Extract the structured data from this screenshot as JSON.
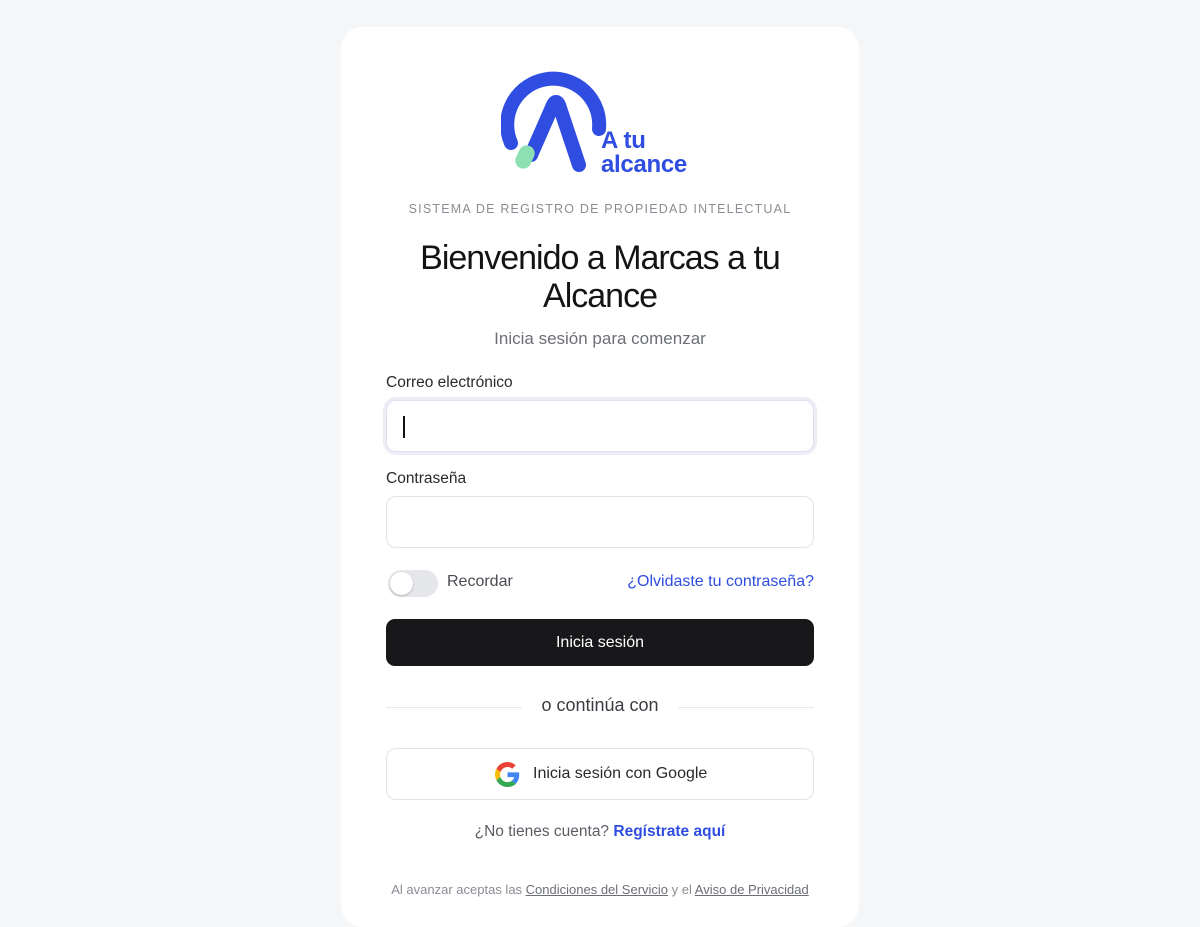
{
  "brand": {
    "logo_line1": "A tu",
    "logo_line2": "alcance",
    "primary_color": "#2f4de0",
    "accent_color": "#8ce0b3"
  },
  "header": {
    "eyebrow": "SISTEMA DE REGISTRO DE PROPIEDAD INTELECTUAL",
    "title": "Bienvenido a Marcas a tu Alcance",
    "subtitle": "Inicia sesión para comenzar"
  },
  "form": {
    "email_label": "Correo electrónico",
    "email_value": "",
    "password_label": "Contraseña",
    "password_value": "",
    "remember_label": "Recordar",
    "remember_checked": false,
    "forgot_link": "¿Olvidaste tu contraseña?",
    "submit_label": "Inicia sesión"
  },
  "alt_login": {
    "divider_text": "o continúa con",
    "google_label": "Inicia sesión con Google",
    "google_icon": "google-g-icon"
  },
  "signup": {
    "prompt": "¿No tienes cuenta?",
    "link": "Regístrate aquí"
  },
  "legal": {
    "prefix": "Al avanzar aceptas las",
    "terms_link": "Condiciones del Servicio",
    "conjunction": "y el",
    "privacy_link": "Aviso de Privacidad"
  }
}
